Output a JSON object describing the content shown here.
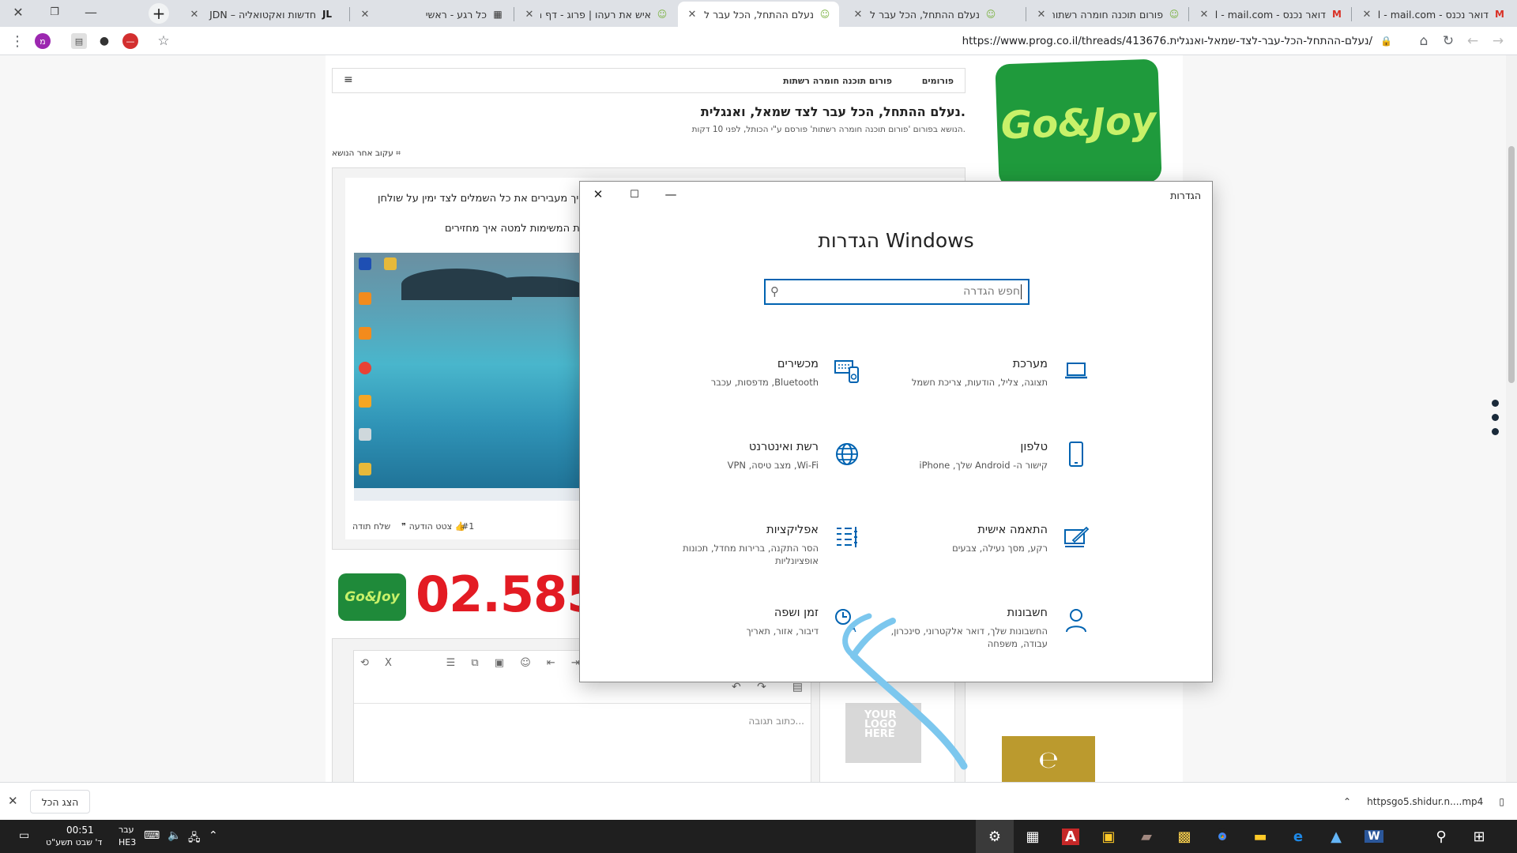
{
  "browser": {
    "tabs": [
      {
        "title": "דואר נכנס - Gmail - mail.com",
        "favicon": "M",
        "fav_color": "#d93025",
        "active": false
      },
      {
        "title": "דואר נכנס - Gmail - mail.com",
        "favicon": "M",
        "fav_color": "#d93025",
        "active": false
      },
      {
        "title": "פורום תוכנה חומרה רשתות",
        "favicon": "☺",
        "fav_color": "#7cb342",
        "active": false
      },
      {
        "title": "נעלם ההתחל, הכל עבר לצד",
        "favicon": "☺",
        "fav_color": "#7cb342",
        "active": false
      },
      {
        "title": "נעלם ההתחל, הכל עבר לצד",
        "favicon": "☺",
        "fav_color": "#7cb342",
        "active": true
      },
      {
        "title": "איש את רעהו | פרוג - דף הב",
        "favicon": "☺",
        "fav_color": "#7cb342",
        "active": false
      },
      {
        "title": "כל רגע - ראשי",
        "favicon": "▦",
        "fav_color": "#333333",
        "active": false
      },
      {
        "title": "חדשות ואקטואליה – JDN",
        "favicon": "JL",
        "fav_color": "#1a1a1a",
        "active": false
      }
    ],
    "url": "https://www.prog.co.il/threads/413676.נעלם-ההתחל-הכל-עבר-לצד-שמאל-ואנגלית/"
  },
  "forum": {
    "breadcrumb_home": "פורומים",
    "breadcrumb_forum": "פורום תוכנה חומרה רשתות",
    "thread_title": "נעלם ההתחל, הכל עבר לצד שמאל, ואנגלית.",
    "thread_meta": "הנושא בפורום 'פורום תוכנה חומרה רשתות' פורסם ע\"י הכותל, לפני 10 דקות.",
    "follow": "עקוב אחר הנושא",
    "post_line1": "איך מעבירים את כל השמלים לצד ימין על שולחן",
    "post_line2": "שורת המשימות למטה איך מחזירים?",
    "post_quote": "צטט הודעה",
    "post_thanks": "שלח תודה",
    "post_number": "#1",
    "ad_number": "02.585",
    "brand": "Go&Joy",
    "reply_placeholder": "כתוב תגובה...",
    "logo_placeholder": "YOUR LOGO HERE"
  },
  "settings_window": {
    "title": "הגדרות",
    "heading": "הגדרות Windows",
    "search_placeholder": "חפש הגדרה",
    "categories": [
      {
        "name": "מערכת",
        "desc": "תצוגה, צליל, הודעות, צריכת חשמל",
        "icon": "laptop-icon"
      },
      {
        "name": "מכשירים",
        "desc": "Bluetooth, מדפסות, עכבר",
        "icon": "devices-icon"
      },
      {
        "name": "טלפון",
        "desc": "קישור ה- Android שלך, iPhone",
        "icon": "phone-icon"
      },
      {
        "name": "רשת ואינטרנט",
        "desc": "Wi-Fi, מצב טיסה, VPN",
        "icon": "globe-icon"
      },
      {
        "name": "התאמה אישית",
        "desc": "רקע, מסך נעילה, צבעים",
        "icon": "personalization-icon"
      },
      {
        "name": "אפליקציות",
        "desc": "הסר התקנה, ברירות מחדל, תכונות אופציונליות",
        "icon": "apps-icon"
      },
      {
        "name": "חשבונות",
        "desc": "החשבונות שלך, דואר אלקטרוני, סינכרון, עבודה, משפחה",
        "icon": "account-icon"
      },
      {
        "name": "זמן ושפה",
        "desc": "דיבור, אזור, תאריך",
        "icon": "time-language-icon"
      }
    ],
    "accent": "#0063b1"
  },
  "downloads": {
    "show_all": "הצג הכל",
    "file": "httpsgo5.shidur.n....mp4"
  },
  "taskbar": {
    "time": "00:51",
    "date": "ד' שבט תשע\"ט",
    "lang": "עבר",
    "lang2": "HE3"
  }
}
